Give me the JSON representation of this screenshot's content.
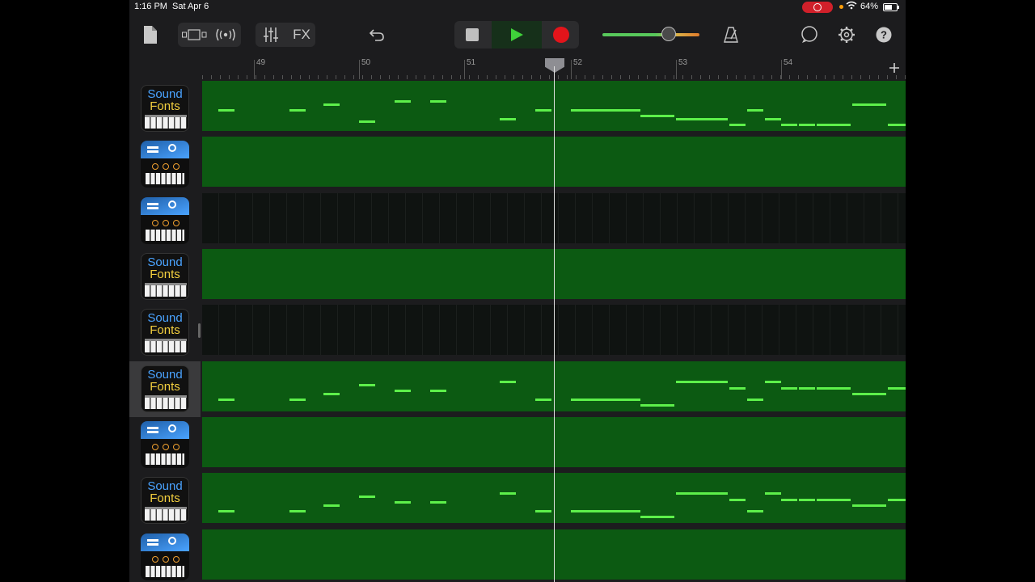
{
  "status": {
    "time": "1:16 PM",
    "date": "Sat Apr 6",
    "battery": "64%"
  },
  "toolbar": {
    "fx_label": "FX"
  },
  "ruler": {
    "bars": [
      "49",
      "50",
      "51",
      "52",
      "53",
      "54"
    ]
  },
  "tracks": [
    {
      "icon": "soundfonts",
      "line1": "Sound",
      "line2": "Fonts",
      "lane": "green",
      "pattern": "A"
    },
    {
      "icon": "synth",
      "lane": "green",
      "pattern": "none"
    },
    {
      "icon": "synth",
      "lane": "dark",
      "pattern": "none"
    },
    {
      "icon": "soundfonts",
      "line1": "Sound",
      "line2": "Fonts",
      "lane": "green",
      "pattern": "none"
    },
    {
      "icon": "soundfonts",
      "line1": "Sound",
      "line2": "Fonts",
      "lane": "dark",
      "pattern": "none"
    },
    {
      "icon": "soundfonts",
      "line1": "Sound",
      "line2": "Fonts",
      "lane": "green",
      "pattern": "B",
      "selected": true
    },
    {
      "icon": "synth",
      "lane": "green",
      "pattern": "none"
    },
    {
      "icon": "soundfonts",
      "line1": "Sound",
      "line2": "Fonts",
      "lane": "green",
      "pattern": "B"
    },
    {
      "icon": "synth",
      "lane": "green",
      "pattern": "none"
    }
  ],
  "colors": {
    "region": "#0c5a12",
    "note": "#5df04a",
    "record": "#e3141b",
    "play": "#3fd13a"
  }
}
